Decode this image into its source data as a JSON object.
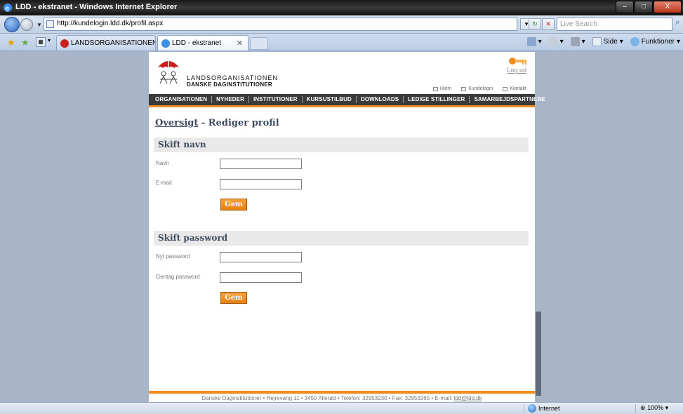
{
  "window": {
    "title": "LDD - ekstranet - Windows Internet Explorer",
    "buttons": {
      "minimize": "–",
      "maximize": "□",
      "close": "X"
    }
  },
  "browser": {
    "address": "http://kundelogin.ldd.dk/profil.aspx",
    "search_placeholder": "Live Search",
    "tabs": [
      {
        "label": "LANDSORGANISATIONEN DA...",
        "active": false
      },
      {
        "label": "LDD - ekstranet",
        "active": true
      }
    ],
    "commands": {
      "page": "Side",
      "tools": "Funktioner"
    },
    "status": {
      "zone": "Internet",
      "zoom": "100%"
    }
  },
  "site": {
    "org_line1": "LANDSORGANISATIONEN",
    "org_line2": "DANSKE DAGINSTITUTIONER",
    "logout": "Log ud",
    "toplinks": [
      "Hjem",
      "Kundelogin",
      "Kontakt"
    ],
    "nav": [
      "ORGANISATIONEN",
      "NYHEDER",
      "INSTITUTIONER",
      "KURSUSTILBUD",
      "DOWNLOADS",
      "LEDIGE STILLINGER",
      "SAMARBEJDSPARTNERE"
    ]
  },
  "main": {
    "breadcrumb_link": "Oversigt",
    "breadcrumb_current": " - Rediger profil",
    "name_section": {
      "title": "Skift navn",
      "name_label": "Navn",
      "name_value": "",
      "email_label": "E-mail",
      "email_value": "",
      "save": "Gem"
    },
    "password_section": {
      "title": "Skift password",
      "new_label": "Nyt password",
      "repeat_label": "Gentag password",
      "save": "Gem"
    }
  },
  "footer": {
    "text": "Danske Daginstitutioner • Hejrevang 11 • 3450 Allerød • Telefon: 32953230 • Fax: 32953265 • E-mail: ",
    "email": "ldd@ldd.dk"
  },
  "colors": {
    "accent": "#f08d1e",
    "nav": "#3a3a3a",
    "heading": "#3f4d60",
    "desktop": "#a8b5c8"
  }
}
